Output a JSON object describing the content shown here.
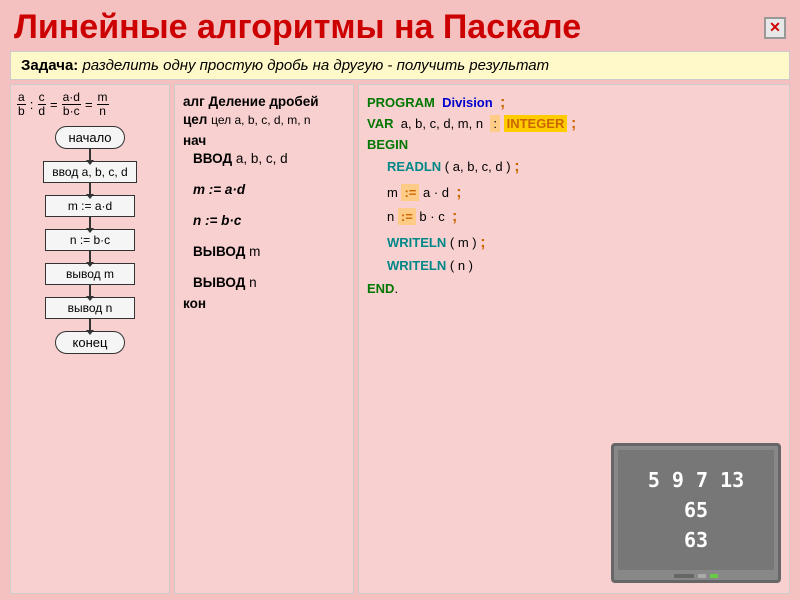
{
  "header": {
    "title": "Линейные алгоритмы на Паскале",
    "close_label": "✕"
  },
  "task": {
    "label": "Задача:",
    "text": " разделить одну простую дробь на другую - получить результат"
  },
  "flowchart": {
    "start": "начало",
    "input": "ввод a, b, c, d",
    "step1": "m := a·d",
    "step2": "n := b·c",
    "output1": "вывод m",
    "output2": "вывод n",
    "end": "конец"
  },
  "algorithm": {
    "alg_line": "алг Деление дробей",
    "cel_line": "цел a, b, c, d, m, n",
    "nach": "нач",
    "vvod": "ВВОД",
    "vvod_vars": "a, b, c, d",
    "m_assign": "m",
    "m_expr": "a · d",
    "n_assign": "n",
    "n_expr": "b · c",
    "vyvod_m": "ВЫВОД",
    "vyvod_m_var": "m",
    "vyvod_n": "ВЫВОД",
    "vyvod_n_var": "n",
    "kon": "кон"
  },
  "pascal": {
    "program": "PROGRAM",
    "division": "Division",
    "semicolon1": ";",
    "var": "VAR",
    "var_list": "a, b, c, d, m, n",
    "colon": ":",
    "integer": "INTEGER",
    "semicolon2": ";",
    "begin": "BEGIN",
    "readln": "READLN",
    "paren1": "(",
    "readln_args": "a, b, c, d",
    "paren2": ")",
    "semicolon3": ";",
    "m_var": "m",
    "assign1": ":=",
    "m_expr": "a · d",
    "semicolon4": ";",
    "n_var": "n",
    "assign2": ":=",
    "n_expr": "b · c",
    "semicolon5": ";",
    "writeln1": "WRITELN",
    "writeln1_paren1": "(",
    "writeln1_arg": "m",
    "writeln1_paren2": ")",
    "semicolon6": ";",
    "writeln2": "WRITELN",
    "writeln2_paren1": "(",
    "writeln2_arg": "n",
    "writeln2_paren2": ")",
    "end": "END",
    "dot": "."
  },
  "monitor": {
    "line1": "5  9  7  13",
    "line2": "65",
    "line3": "63"
  }
}
